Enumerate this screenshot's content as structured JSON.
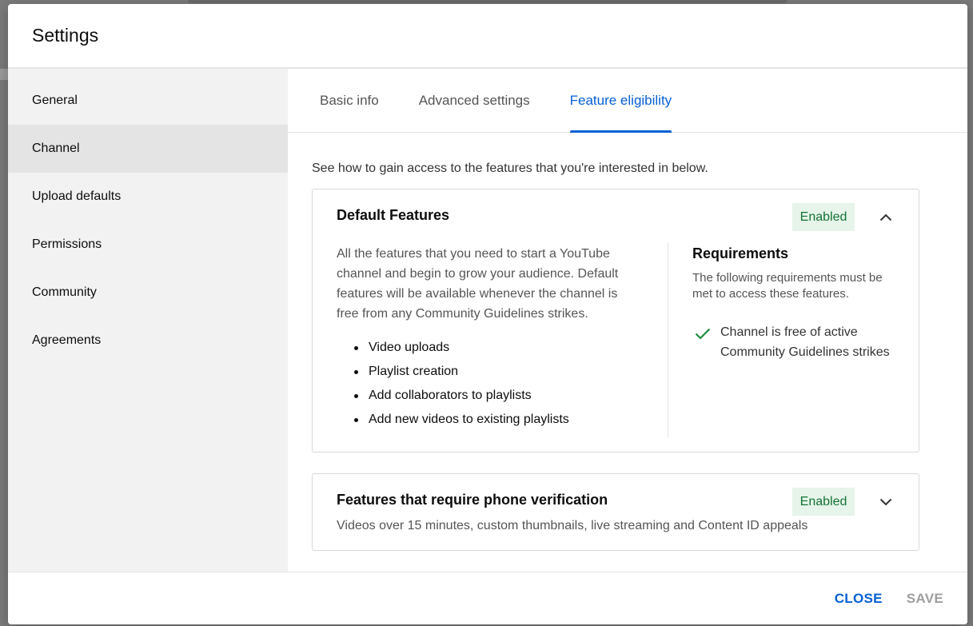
{
  "dialog": {
    "title": "Settings"
  },
  "sidebar": {
    "items": [
      {
        "label": "General",
        "active": false
      },
      {
        "label": "Channel",
        "active": true
      },
      {
        "label": "Upload defaults",
        "active": false
      },
      {
        "label": "Permissions",
        "active": false
      },
      {
        "label": "Community",
        "active": false
      },
      {
        "label": "Agreements",
        "active": false
      }
    ]
  },
  "tabs": [
    {
      "label": "Basic info",
      "active": false
    },
    {
      "label": "Advanced settings",
      "active": false
    },
    {
      "label": "Feature eligibility",
      "active": true
    }
  ],
  "main": {
    "intro": "See how to gain access to the features that you're interested in below.",
    "default_features": {
      "title": "Default Features",
      "status": "Enabled",
      "expand_icon": "chevron-up-icon",
      "description": "All the features that you need to start a YouTube channel and begin to grow your audience. Default features will be available whenever the channel is free from any Community Guidelines strikes.",
      "features": [
        "Video uploads",
        "Playlist creation",
        "Add collaborators to playlists",
        "Add new videos to existing playlists"
      ],
      "requirements": {
        "title": "Requirements",
        "description": "The following requirements must be met to access these features.",
        "items": [
          {
            "icon": "checkmark-icon",
            "text": "Channel is free of active Community Guidelines strikes"
          }
        ]
      }
    },
    "phone_features": {
      "title": "Features that require phone verification",
      "status": "Enabled",
      "expand_icon": "chevron-down-icon",
      "description": "Videos over 15 minutes, custom thumbnails, live streaming and Content ID appeals"
    }
  },
  "footer": {
    "close_label": "CLOSE",
    "save_label": "SAVE"
  },
  "colors": {
    "accent": "#065fd4",
    "enabled_bg": "#e6f4ea",
    "enabled_text": "#137333",
    "check_green": "#1e8e3e"
  }
}
